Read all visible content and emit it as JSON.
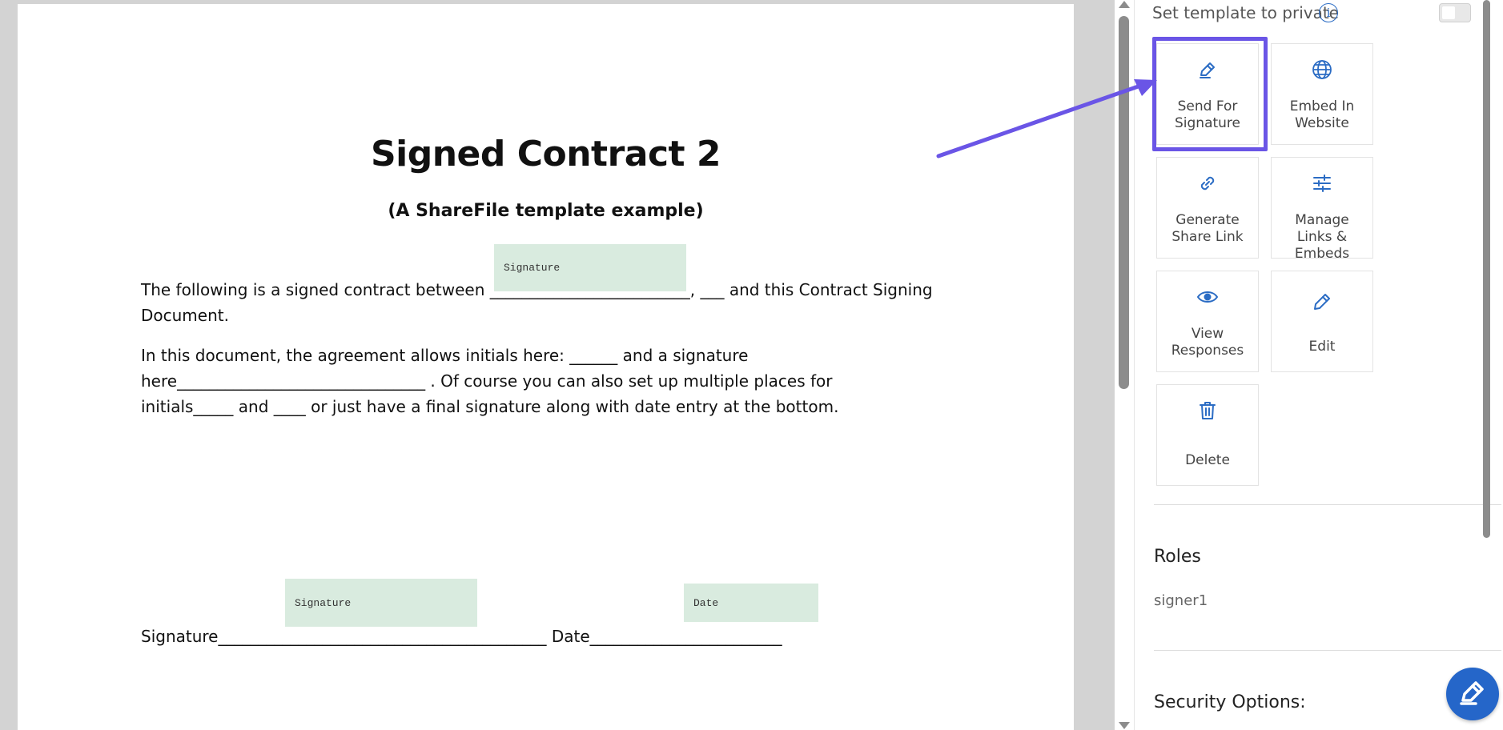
{
  "document": {
    "title": "Signed Contract 2",
    "subtitle": "(A ShareFile template example)",
    "paragraph1": "The following is a signed contract between _________________________, ___ and this Contract Signing\nDocument.",
    "paragraph2": "In this document, the agreement allows initials here: ______ and a signature\nhere_______________________________ . Of course you can also set up multiple places for\ninitials_____ and ____ or just have a final signature along with date entry at the bottom.",
    "signature_line": "Signature_________________________________________ Date________________________",
    "fields": {
      "signature1": "Signature",
      "signature2": "Signature",
      "date": "Date"
    }
  },
  "panel": {
    "private_label": "Set template to private",
    "private_enabled": false,
    "info_glyph": "i",
    "actions": {
      "send": {
        "label": "Send For Signature",
        "icon": "pen-icon"
      },
      "embed": {
        "label": "Embed In Website",
        "icon": "globe-icon"
      },
      "share": {
        "label": "Generate Share Link",
        "icon": "link-icon"
      },
      "manage": {
        "label": "Manage Links & Embeds",
        "icon": "sliders-icon"
      },
      "view": {
        "label": "View Responses",
        "icon": "eye-icon"
      },
      "edit": {
        "label": "Edit",
        "icon": "pencil-icon"
      },
      "delete": {
        "label": "Delete",
        "icon": "trash-icon"
      }
    },
    "roles_heading": "Roles",
    "roles": [
      "signer1"
    ],
    "security_heading": "Security Options:"
  },
  "colors": {
    "accent": "#2b6cc4",
    "highlight": "#6a55e6",
    "field_bg": "#d9ebdf",
    "viewer_bg": "#d3d3d3"
  }
}
